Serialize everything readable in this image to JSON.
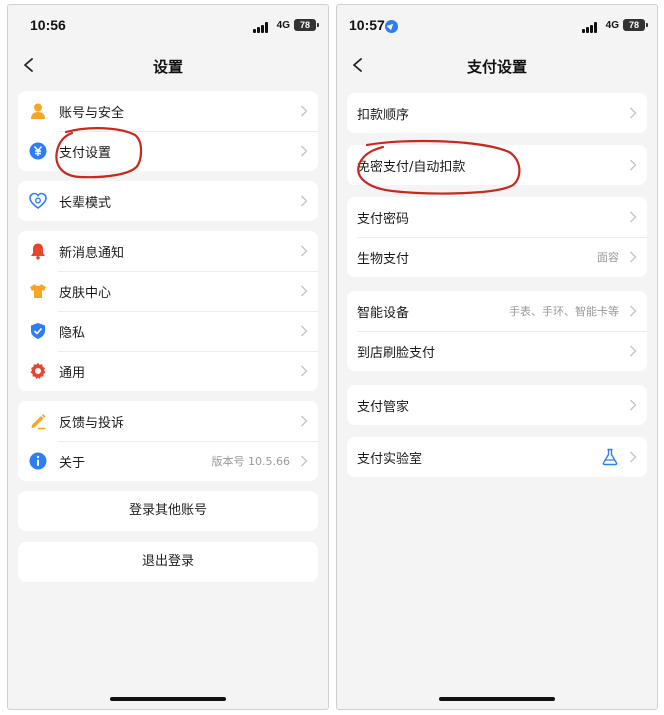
{
  "left": {
    "status": {
      "time": "10:56",
      "network": "4G",
      "battery": "78"
    },
    "nav": {
      "title": "设置"
    },
    "groups": [
      {
        "items": [
          {
            "label": "账号与安全"
          },
          {
            "label": "支付设置"
          }
        ]
      },
      {
        "items": [
          {
            "label": "长辈模式"
          }
        ]
      },
      {
        "items": [
          {
            "label": "新消息通知"
          },
          {
            "label": "皮肤中心"
          },
          {
            "label": "隐私"
          },
          {
            "label": "通用"
          }
        ]
      },
      {
        "items": [
          {
            "label": "反馈与投诉"
          },
          {
            "label": "关于",
            "value": "版本号 10.5.66"
          }
        ]
      }
    ],
    "buttons": {
      "switch_account": "登录其他账号",
      "logout": "退出登录"
    }
  },
  "right": {
    "status": {
      "time": "10:57",
      "network": "4G",
      "battery": "78"
    },
    "nav": {
      "title": "支付设置"
    },
    "groups": [
      {
        "items": [
          {
            "label": "扣款顺序"
          }
        ]
      },
      {
        "items": [
          {
            "label": "免密支付/自动扣款"
          }
        ]
      },
      {
        "items": [
          {
            "label": "支付密码"
          },
          {
            "label": "生物支付",
            "value": "面容"
          }
        ]
      },
      {
        "items": [
          {
            "label": "智能设备",
            "value": "手表、手环、智能卡等"
          },
          {
            "label": "到店刷脸支付"
          }
        ]
      },
      {
        "items": [
          {
            "label": "支付管家"
          }
        ]
      },
      {
        "items": [
          {
            "label": "支付实验室"
          }
        ]
      }
    ]
  },
  "icons": {
    "account": "person-icon",
    "payment": "yuan-icon",
    "elder": "heart-icon",
    "notify": "bell-icon",
    "skin": "tshirt-icon",
    "privacy": "shield-icon",
    "general": "gear-icon",
    "feedback": "pencil-icon",
    "about": "info-icon",
    "lab": "flask-icon"
  },
  "colors": {
    "accent": "#2f7df6",
    "orange": "#f5a623",
    "red": "#e8452c",
    "annotation": "#c8281e"
  }
}
